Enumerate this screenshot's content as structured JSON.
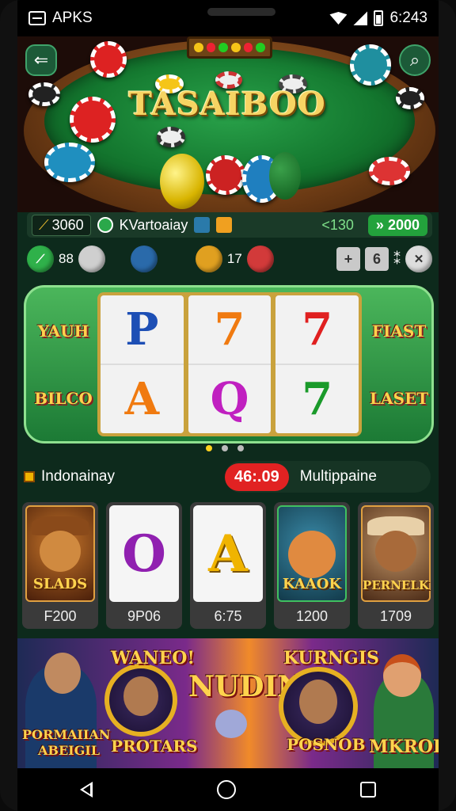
{
  "status_bar": {
    "app_label": "APKS",
    "time": "6:243"
  },
  "hero": {
    "title": "TASAIBOO",
    "back_icon": "back-arrow-icon",
    "search_icon": "search-icon"
  },
  "info_bar": {
    "coins": "3060",
    "username": "KVartoaiay",
    "bet": "130",
    "bet_prefix": "<",
    "balance": "2000",
    "balance_prefix": "»"
  },
  "toolbar": {
    "items": [
      {
        "label": "88",
        "icon": "coin-green-icon"
      },
      {
        "label": "",
        "icon": "coin-silver-icon"
      },
      {
        "label": "",
        "icon": "coin-blue-icon"
      },
      {
        "label": "17",
        "icon": "coin-gold-icon"
      },
      {
        "label": "",
        "icon": "coin-red-icon"
      }
    ],
    "plus_label": "+",
    "count_value": "6",
    "settings_icon": "gear-icon"
  },
  "slot": {
    "left_logo_top": "YAUH",
    "left_logo_bottom": "BILCO",
    "right_logo_top": "FIAST",
    "right_logo_bottom": "LASET",
    "reels": [
      {
        "top": "P",
        "bottom": "A"
      },
      {
        "top": "7",
        "bottom": "Q"
      },
      {
        "top": "7",
        "bottom": "7"
      }
    ]
  },
  "status_row": {
    "region": "Indonainay",
    "timer": "46:.09",
    "mode": "Multippaine"
  },
  "games": [
    {
      "name": "SLADS",
      "value": "F200"
    },
    {
      "name": "",
      "letter": "O",
      "value": "9P06"
    },
    {
      "name": "",
      "letter": "A",
      "value": "6:75"
    },
    {
      "name": "KAAOK",
      "value": "1200"
    },
    {
      "name": "PERNELK",
      "value": "1709"
    }
  ],
  "banner": {
    "left_label_1": "PORMAIIAN",
    "left_label_2": "ABEIGIL",
    "wanted": "WANEO!",
    "prostars": "PROTARS",
    "center_title": "NUDINS",
    "kings": "KURNGIS",
    "posnob": "POSNOB",
    "mkroi": "MKROI"
  },
  "colors": {
    "felt": "#14782f",
    "accent_green": "#23a23c",
    "timer_red": "#e12222",
    "gold": "#f6d463"
  }
}
